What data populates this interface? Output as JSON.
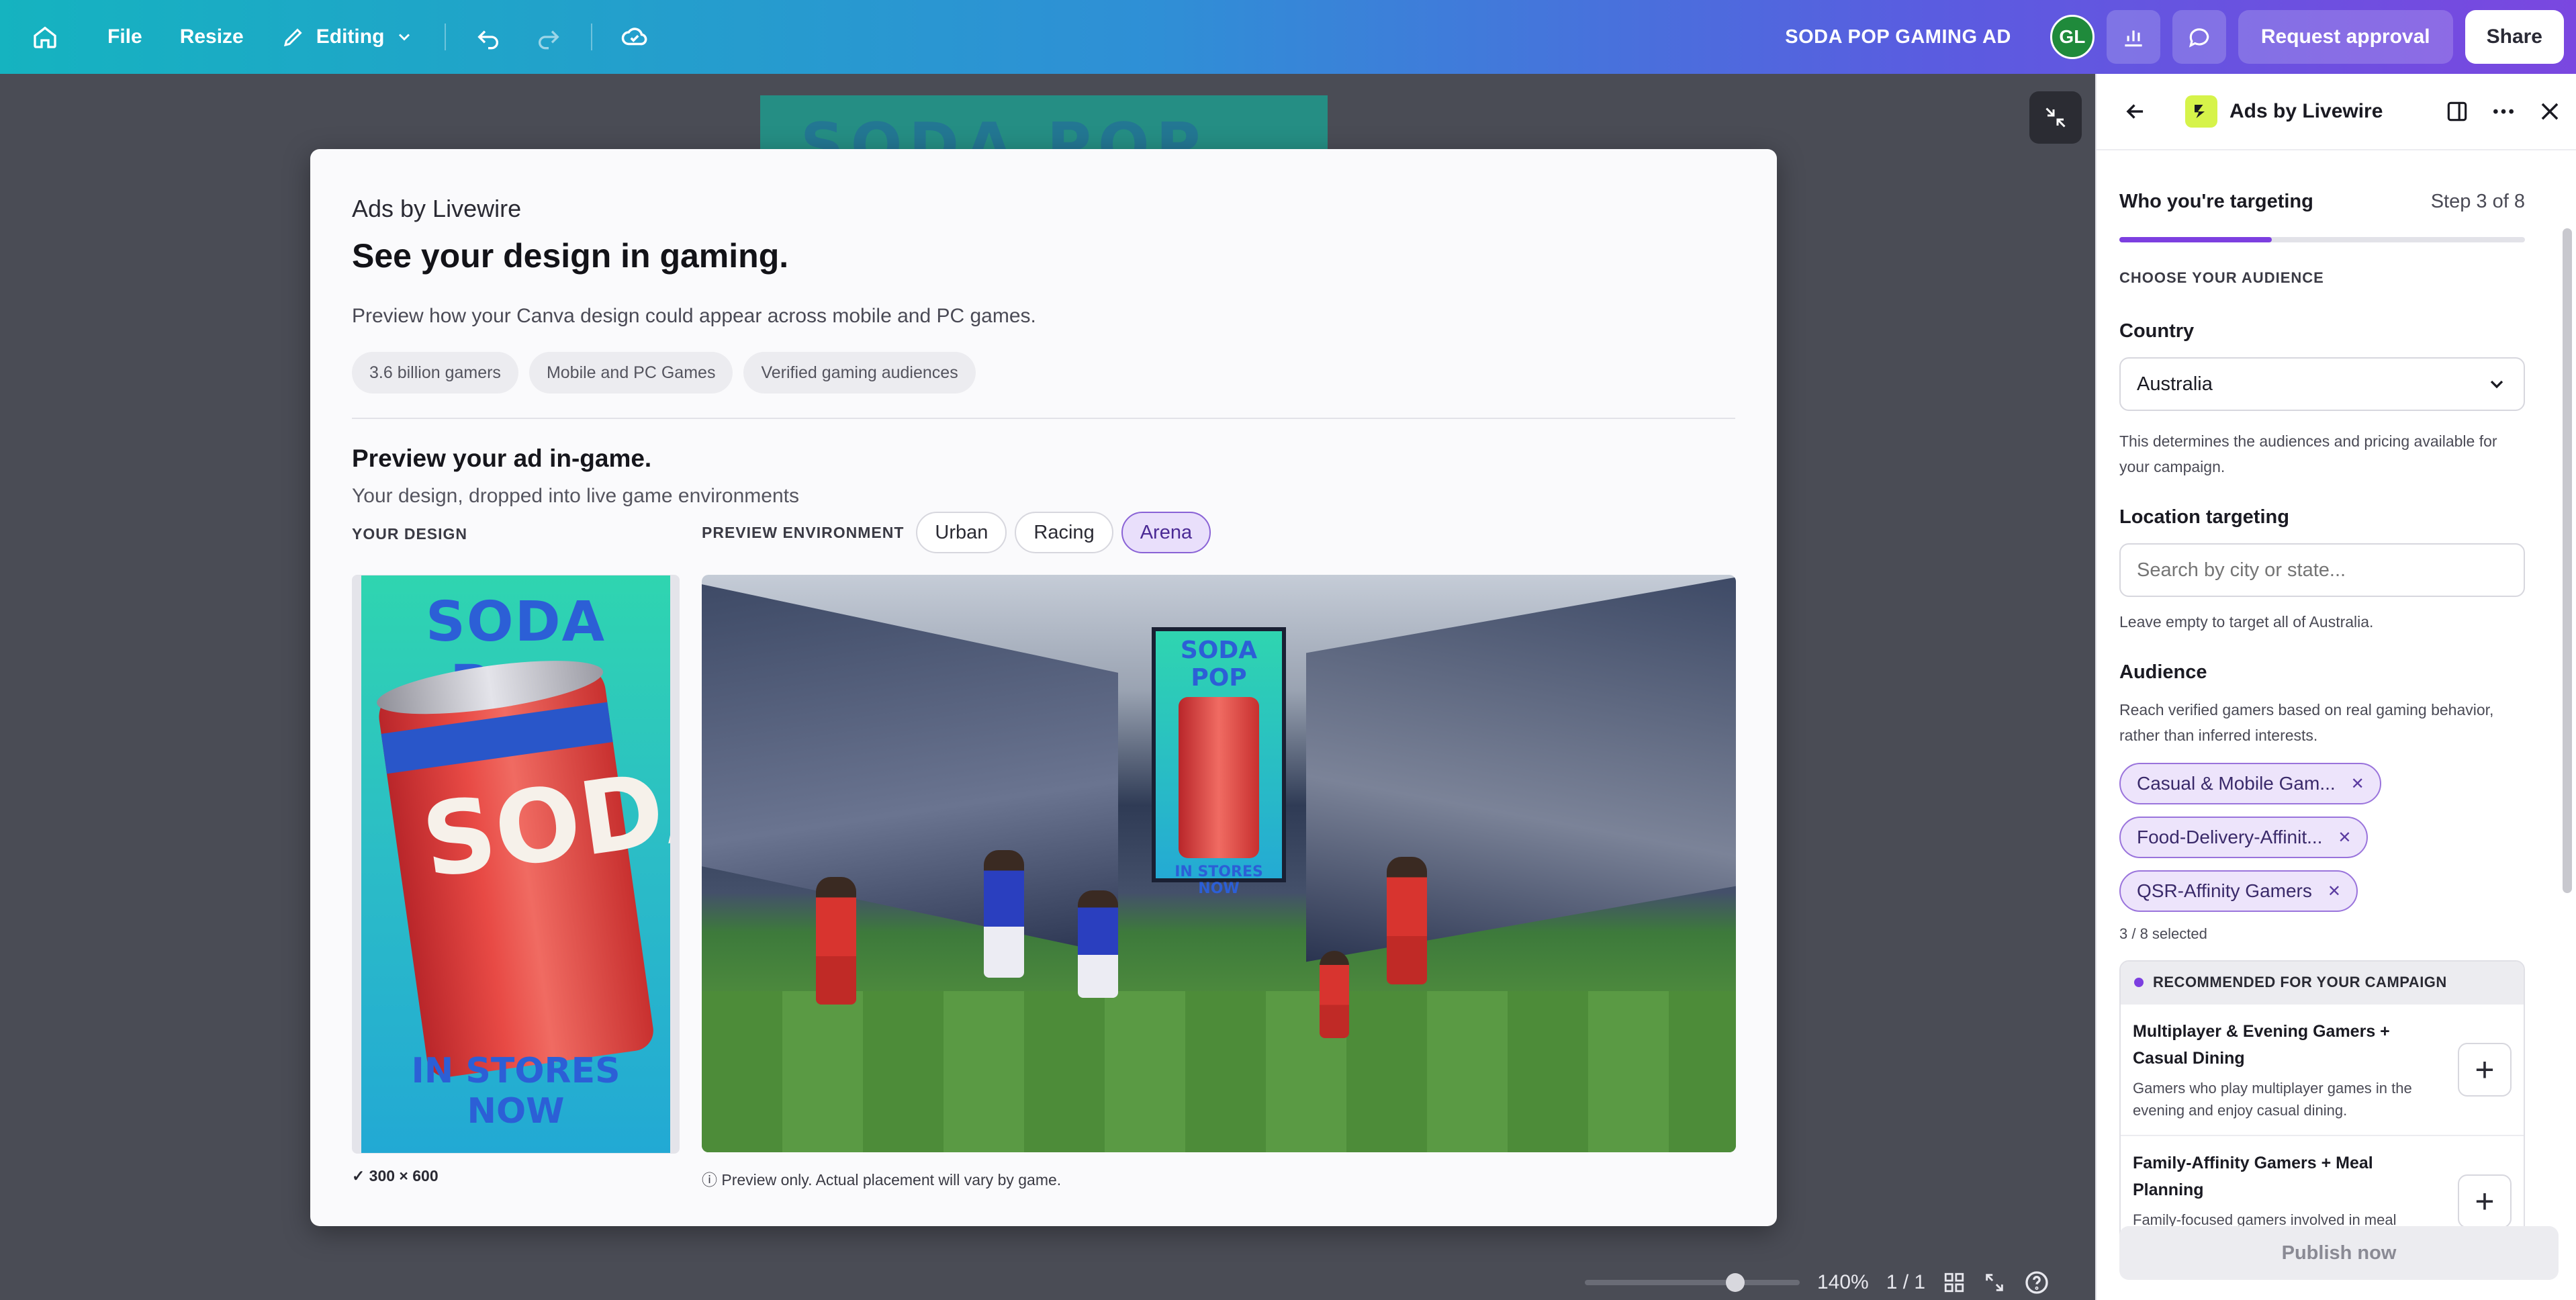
{
  "topbar": {
    "file_label": "File",
    "resize_label": "Resize",
    "editing_label": "Editing",
    "design_title": "SODA POP GAMING AD",
    "avatar_initials": "GL",
    "request_approval_label": "Request approval",
    "share_label": "Share"
  },
  "canvas": {
    "ghost_title": "SODA POP",
    "zoom_percent": "140%",
    "page_indicator": "1 / 1",
    "zoom_value": 0.7
  },
  "modal": {
    "brand": "Ads by Livewire",
    "title": "See your design in gaming.",
    "description": "Preview how your Canva design could appear across mobile and PC games.",
    "chips": [
      "3.6 billion gamers",
      "Mobile and PC Games",
      "Verified gaming audiences"
    ],
    "preview_heading": "Preview your ad in-game.",
    "preview_subheading": "Your design, dropped into live game environments",
    "your_design_label": "YOUR DESIGN",
    "preview_env_label": "PREVIEW ENVIRONMENT",
    "env_tabs": [
      "Urban",
      "Racing",
      "Arena"
    ],
    "active_env": "Arena",
    "design_size_note": "✓ 300 × 600",
    "preview_note": "ⓘ Preview only. Actual placement will vary by game.",
    "design_headline": "SODA POP",
    "design_can_text": "SODA",
    "design_footer": "IN STORES NOW",
    "adboard_headline": "SODA POP",
    "adboard_footer": "IN STORES NOW"
  },
  "panel": {
    "app_name": "Ads by Livewire",
    "step_title": "Who you're targeting",
    "step_indicator": "Step 3 of 8",
    "step_progress": 0.375,
    "section_label": "CHOOSE YOUR AUDIENCE",
    "country_label": "Country",
    "country_value": "Australia",
    "country_help": "This determines the audiences and pricing available for your campaign.",
    "location_label": "Location targeting",
    "location_placeholder": "Search by city or state...",
    "location_help": "Leave empty to target all of Australia.",
    "audience_label": "Audience",
    "audience_help": "Reach verified gamers based on real gaming behavior, rather than inferred interests.",
    "selected_audiences": [
      "Casual & Mobile Gam...",
      "Food-Delivery-Affinit...",
      "QSR-Affinity Gamers"
    ],
    "selected_count": "3 / 8 selected",
    "recommended_header": "RECOMMENDED FOR YOUR CAMPAIGN",
    "recommendations": [
      {
        "title": "Multiplayer & Evening Gamers + Casual Dining",
        "desc": "Gamers who play multiplayer games in the evening and enjoy casual dining."
      },
      {
        "title": "Family-Affinity Gamers + Meal Planning",
        "desc": "Family-focused gamers involved in meal planning and food shopping."
      }
    ],
    "publish_label": "Publish now"
  },
  "colors": {
    "accent": "#7c3fe0",
    "brand_gradient_start": "#15b3c0",
    "brand_gradient_end": "#7a47e0"
  }
}
